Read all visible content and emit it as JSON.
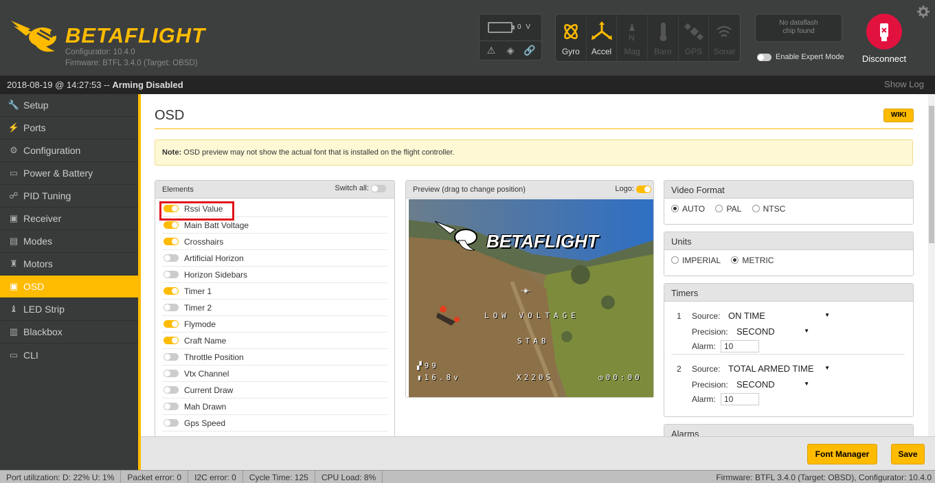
{
  "app": {
    "name": "BETAFLIGHT",
    "configurator": "Configurator: 10.4.0",
    "firmware": "Firmware: BTFL 3.4.0 (Target: OBSD)"
  },
  "battery": {
    "voltage": "0 V"
  },
  "sensors": [
    {
      "label": "Gyro",
      "active": true
    },
    {
      "label": "Accel",
      "active": true
    },
    {
      "label": "Mag",
      "active": false
    },
    {
      "label": "Baro",
      "active": false
    },
    {
      "label": "GPS",
      "active": false
    },
    {
      "label": "Sonar",
      "active": false
    }
  ],
  "dataflash": {
    "line1": "No dataflash",
    "line2": "chip found"
  },
  "expert_mode": {
    "label": "Enable Expert Mode",
    "enabled": false
  },
  "disconnect": {
    "label": "Disconnect"
  },
  "status": {
    "datetime": "2018-08-19 @ 14:27:53 -- ",
    "arming": "Arming Disabled",
    "show_log": "Show Log"
  },
  "sidebar": {
    "items": [
      {
        "label": "Setup",
        "icon": "wrench-icon"
      },
      {
        "label": "Ports",
        "icon": "plug-icon"
      },
      {
        "label": "Configuration",
        "icon": "gear-icon"
      },
      {
        "label": "Power & Battery",
        "icon": "battery-icon"
      },
      {
        "label": "PID Tuning",
        "icon": "pid-icon"
      },
      {
        "label": "Receiver",
        "icon": "receiver-icon"
      },
      {
        "label": "Modes",
        "icon": "modes-icon"
      },
      {
        "label": "Motors",
        "icon": "motor-icon"
      },
      {
        "label": "OSD",
        "icon": "osd-icon",
        "active": true
      },
      {
        "label": "LED Strip",
        "icon": "led-icon"
      },
      {
        "label": "Blackbox",
        "icon": "blackbox-icon"
      },
      {
        "label": "CLI",
        "icon": "cli-icon"
      }
    ]
  },
  "osd": {
    "title": "OSD",
    "wiki": "WIKI",
    "note_bold": "Note:",
    "note_text": " OSD preview may not show the actual font that is installed on the flight controller.",
    "elements": {
      "title": "Elements",
      "switch_all": "Switch all:",
      "items": [
        {
          "label": "Rssi Value",
          "on": true
        },
        {
          "label": "Main Batt Voltage",
          "on": true
        },
        {
          "label": "Crosshairs",
          "on": true
        },
        {
          "label": "Artificial Horizon",
          "on": false
        },
        {
          "label": "Horizon Sidebars",
          "on": false
        },
        {
          "label": "Timer 1",
          "on": true
        },
        {
          "label": "Timer 2",
          "on": false
        },
        {
          "label": "Flymode",
          "on": true
        },
        {
          "label": "Craft Name",
          "on": true
        },
        {
          "label": "Throttle Position",
          "on": false
        },
        {
          "label": "Vtx Channel",
          "on": false
        },
        {
          "label": "Current Draw",
          "on": false
        },
        {
          "label": "Mah Drawn",
          "on": false
        },
        {
          "label": "Gps Speed",
          "on": false
        }
      ]
    },
    "preview": {
      "title": "Preview (drag to change position)",
      "logo": "Logo:",
      "logo_text": "BETAFLIGHT",
      "warning": "LOW VOLTAGE",
      "mode": "STAB",
      "rssi": "99",
      "voltage": "16.8v",
      "craft": "X220S",
      "timer": "00:00"
    },
    "video_format": {
      "title": "Video Format",
      "options": [
        "AUTO",
        "PAL",
        "NTSC"
      ],
      "selected": "AUTO"
    },
    "units": {
      "title": "Units",
      "options": [
        "IMPERIAL",
        "METRIC"
      ],
      "selected": "METRIC"
    },
    "timers": {
      "title": "Timers",
      "source_label": "Source:",
      "precision_label": "Precision:",
      "alarm_label": "Alarm:",
      "items": [
        {
          "num": "1",
          "source": "ON TIME",
          "precision": "SECOND",
          "alarm": "10"
        },
        {
          "num": "2",
          "source": "TOTAL ARMED TIME",
          "precision": "SECOND",
          "alarm": "10"
        }
      ]
    },
    "alarms": {
      "title": "Alarms"
    },
    "font_manager": "Font Manager",
    "save": "Save"
  },
  "footer": {
    "port": "Port utilization: D: 22% U: 1%",
    "packet": "Packet error: 0",
    "i2c": "I2C error: 0",
    "cycle": "Cycle Time: 125",
    "cpu": "CPU Load: 8%",
    "firmware": "Firmware: BTFL 3.4.0 (Target: OBSD), Configurator: 10.4.0"
  },
  "colors": {
    "accent": "#ffbb00",
    "disconnect": "#e2123f",
    "highlight": "#e0101a"
  }
}
